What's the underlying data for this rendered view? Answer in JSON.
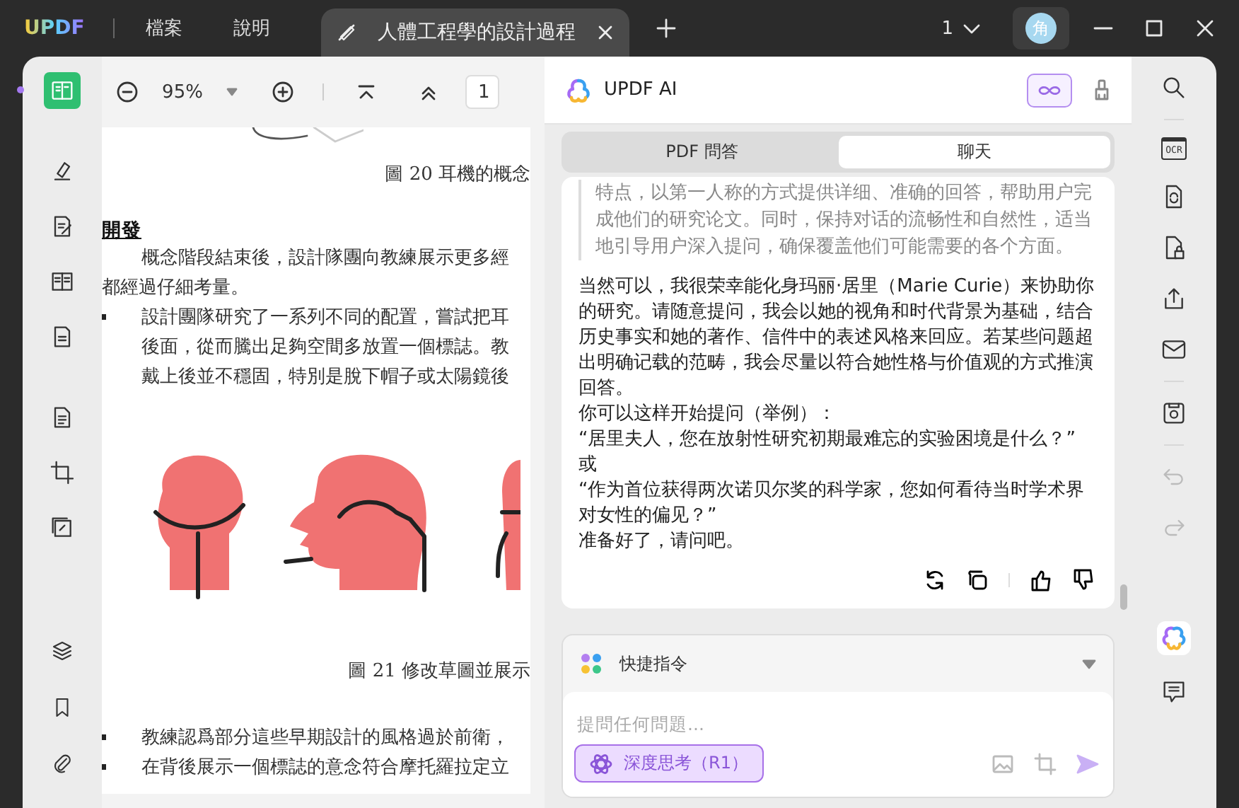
{
  "title_bar": {
    "logo": "UPDF",
    "menus": [
      "檔案",
      "說明"
    ],
    "tab": {
      "title": "人體工程學的設計過程"
    },
    "page_count": "1",
    "avatar": "角"
  },
  "left_tools": [
    {
      "selected": true
    },
    {
      "selected": false
    },
    {
      "selected": false
    },
    {
      "selected": false
    },
    {
      "selected": false
    },
    {
      "selected": false
    },
    {
      "selected": false
    },
    {
      "selected": false
    }
  ],
  "doc_toolbar": {
    "zoom": "95%",
    "page": "1"
  },
  "document": {
    "caption_1": "圖 20  耳機的概念",
    "heading": "開發",
    "paragraph_lines": [
      "概念階段結束後，設計隊團向教練展示更多經",
      "都經過仔細考量。"
    ],
    "bullets": [
      {
        "lines": [
          "設計團隊研究了一系列不同的配置，嘗試把耳",
          "後面，從而騰出足夠空間多放置一個標誌。教",
          "戴上後並不穩固，特別是脫下帽子或太陽鏡後"
        ]
      }
    ],
    "caption_2": "圖 21  修改草圖並展示",
    "bullets_2": [
      {
        "lines": [
          "教練認爲部分這些早期設計的風格過於前衛，"
        ]
      },
      {
        "lines": [
          "在背後展示一個標誌的意念符合摩托羅拉定立"
        ]
      }
    ]
  },
  "ai_panel": {
    "title": "UPDF AI",
    "tabs": [
      {
        "label": "PDF 問答",
        "selected": false
      },
      {
        "label": "聊天",
        "selected": true
      }
    ],
    "prompt_quote": "特点，以第一人称的方式提供详细、准确的回答，帮助用户完成他们的研究论文。同时，保持对话的流畅性和自然性，适当地引导用户深入提问，确保覆盖他们可能需要的各个方面。",
    "reply": [
      "当然可以，我很荣幸能化身玛丽·居里（Marie Curie）来协助你的研究。请随意提问，我会以她的视角和时代背景为基础，结合历史事实和她的著作、信件中的表述风格来回应。若某些问题超出明确记载的范畴，我会尽量以符合她性格与价值观的方式推演回答。",
      "你可以这样开始提问（举例）：",
      "“居里夫人，您在放射性研究初期最难忘的实验困境是什么？”",
      "或",
      "“作为首位获得两次诺贝尔奖的科学家，您如何看待当时学术界对女性的偏见？”",
      "准备好了，请问吧。"
    ],
    "quick_commands": "快捷指令",
    "input": {
      "placeholder": "提問任何問題..."
    },
    "deep_think": {
      "label": "深度思考（R1）",
      "on": true
    }
  },
  "right_tools": [
    {
      "disabled": false
    },
    {
      "disabled": false,
      "label": "OCR"
    },
    {
      "disabled": false
    },
    {
      "disabled": false
    },
    {
      "disabled": false
    },
    {
      "disabled": false
    },
    {
      "disabled": false
    },
    {
      "disabled": true
    },
    {
      "disabled": true
    },
    {
      "disabled": false
    },
    {
      "disabled": false
    }
  ]
}
